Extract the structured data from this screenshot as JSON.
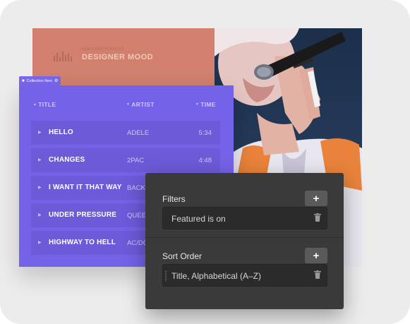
{
  "playlist": {
    "eyebrow": "FEATURED PLAYLIST",
    "title": "DESIGNER MOOD"
  },
  "collection_tag": {
    "label": "Collection Item"
  },
  "table": {
    "headers": {
      "title": "TITLE",
      "artist": "ARTIST",
      "time": "TIME"
    },
    "rows": [
      {
        "title": "HELLO",
        "artist": "ADELE",
        "time": "5:34"
      },
      {
        "title": "CHANGES",
        "artist": "2PAC",
        "time": "4:48"
      },
      {
        "title": "I WANT IT THAT WAY",
        "artist": "BACKS",
        "time": ""
      },
      {
        "title": "UNDER PRESSURE",
        "artist": "QUEEN",
        "time": ""
      },
      {
        "title": "HIGHWAY TO HELL",
        "artist": "AC/DC",
        "time": ""
      }
    ]
  },
  "filters_panel": {
    "filters_label": "Filters",
    "filter_value": "Featured is on",
    "sort_label": "Sort Order",
    "sort_value": "Title, Alphabetical (A–Z)",
    "add_symbol": "+"
  },
  "colors": {
    "accent_purple": "#7462e8",
    "header_salmon": "#d0806c",
    "panel_dark": "#3a3a3a"
  }
}
